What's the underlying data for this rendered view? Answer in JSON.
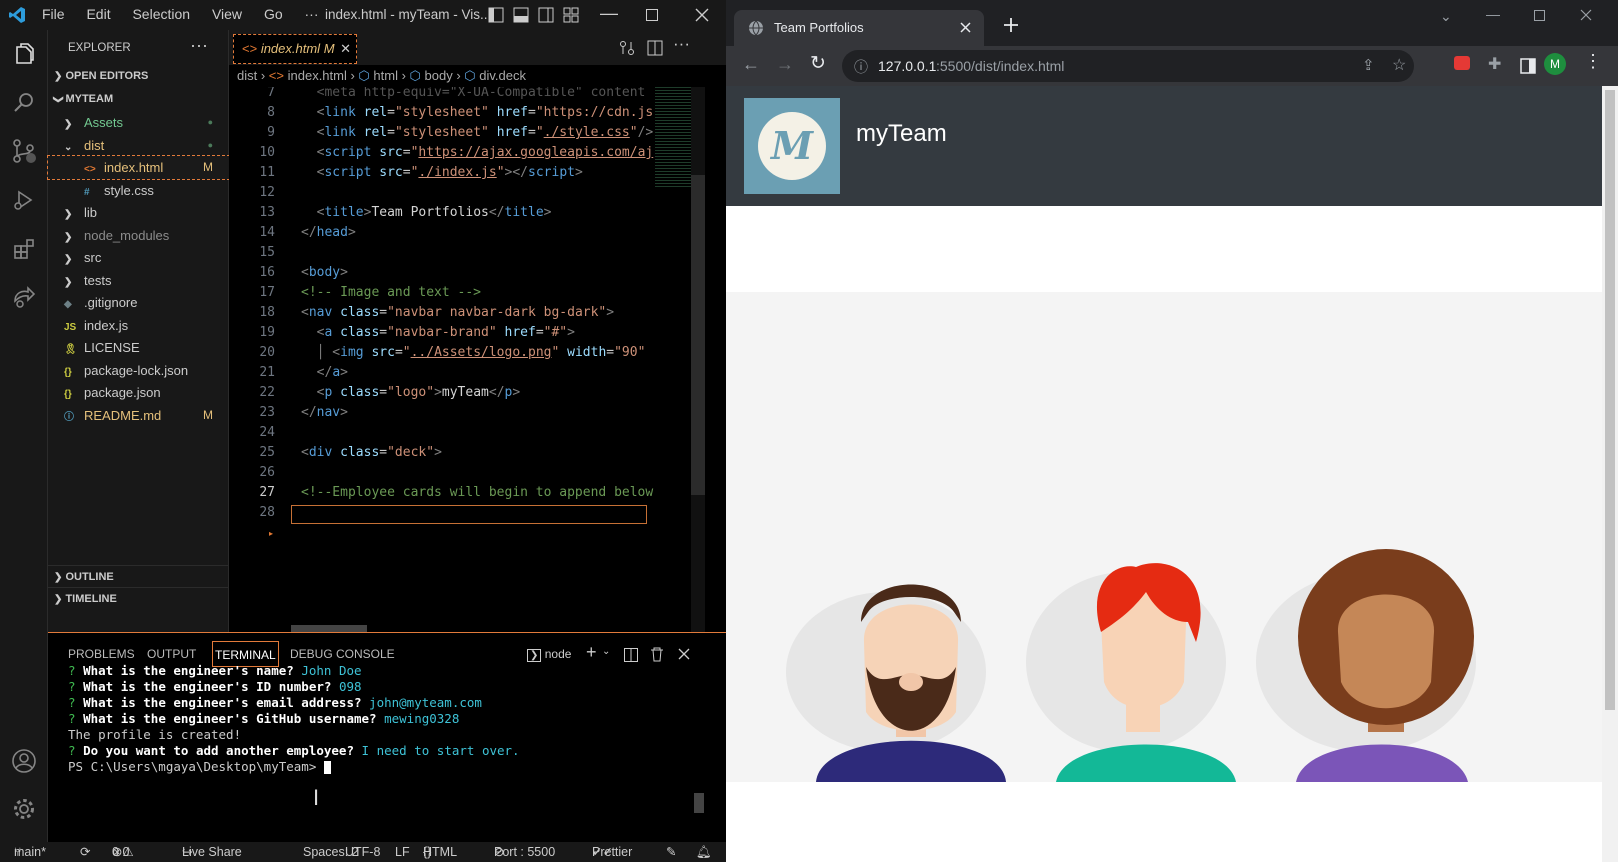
{
  "vscode": {
    "menu": [
      "File",
      "Edit",
      "Selection",
      "View",
      "Go",
      "···"
    ],
    "window_title": "index.html - myTeam - Vis...",
    "explorer_label": "EXPLORER",
    "open_editors": "OPEN EDITORS",
    "project": "MYTEAM",
    "files": [
      {
        "name": "Assets",
        "kind": "folder",
        "color": "#73c991",
        "badge": "●"
      },
      {
        "name": "dist",
        "kind": "folder-open",
        "color": "#e5c07b",
        "badge": "●"
      },
      {
        "name": "index.html",
        "kind": "html",
        "color": "#e5c07b",
        "badge": "M"
      },
      {
        "name": "style.css",
        "kind": "css",
        "color": "#ccc",
        "badge": ""
      },
      {
        "name": "lib",
        "kind": "folder",
        "color": "#ccc",
        "badge": ""
      },
      {
        "name": "node_modules",
        "kind": "folder",
        "color": "#8c8c8c",
        "badge": ""
      },
      {
        "name": "src",
        "kind": "folder",
        "color": "#ccc",
        "badge": ""
      },
      {
        "name": "tests",
        "kind": "folder",
        "color": "#ccc",
        "badge": ""
      },
      {
        "name": ".gitignore",
        "kind": "git",
        "color": "#ccc",
        "badge": ""
      },
      {
        "name": "index.js",
        "kind": "js",
        "color": "#ccc",
        "badge": ""
      },
      {
        "name": "LICENSE",
        "kind": "license",
        "color": "#ccc",
        "badge": ""
      },
      {
        "name": "package-lock.json",
        "kind": "json",
        "color": "#ccc",
        "badge": ""
      },
      {
        "name": "package.json",
        "kind": "json",
        "color": "#ccc",
        "badge": ""
      },
      {
        "name": "README.md",
        "kind": "info",
        "color": "#e5c07b",
        "badge": "M"
      }
    ],
    "outline": "OUTLINE",
    "timeline": "TIMELINE",
    "tab": {
      "name": "index.html",
      "badge": "M"
    },
    "breadcrumbs": [
      "dist",
      "index.html",
      "html",
      "body",
      "div.deck"
    ],
    "line_numbers": [
      "7",
      "8",
      "9",
      "10",
      "11",
      "12",
      "13",
      "14",
      "15",
      "16",
      "17",
      "18",
      "19",
      "20",
      "21",
      "22",
      "23",
      "24",
      "25",
      "26",
      "27",
      "28"
    ],
    "panel_tabs": [
      "PROBLEMS",
      "OUTPUT",
      "TERMINAL",
      "DEBUG CONSOLE"
    ],
    "terminal_shell": "node",
    "terminal": [
      {
        "q": "What is the engineer's name?",
        "a": "John Doe"
      },
      {
        "q": "What is the engineer's ID number?",
        "a": "098"
      },
      {
        "q": "What is the engineer's email address?",
        "a": "john@myteam.com"
      },
      {
        "q": "What is the engineer's GitHub username?",
        "a": "mewing0328"
      }
    ],
    "created_msg": "The profile is created!",
    "another_q": "Do you want to add another employee?",
    "another_a": "I need to start over.",
    "prompt": "PS C:\\Users\\mgaya\\Desktop\\myTeam> ",
    "status": {
      "branch": "main*",
      "errors": "0",
      "warnings": "0",
      "live_share": "Live Share",
      "spaces": "Spaces: 2",
      "encoding": "UTF-8",
      "eol": "LF",
      "language": "HTML",
      "port": "Port : 5500",
      "prettier": "Prettier"
    }
  },
  "chrome": {
    "tab_title": "Team Portfolios",
    "url_host": "127.0.0.1",
    "url_path": ":5500/dist/index.html",
    "profile": "M",
    "site": {
      "brand": "myTeam",
      "logo_letter": "M",
      "logo_bg": "#6b9fb3",
      "navbar_bg": "#343a40"
    }
  }
}
